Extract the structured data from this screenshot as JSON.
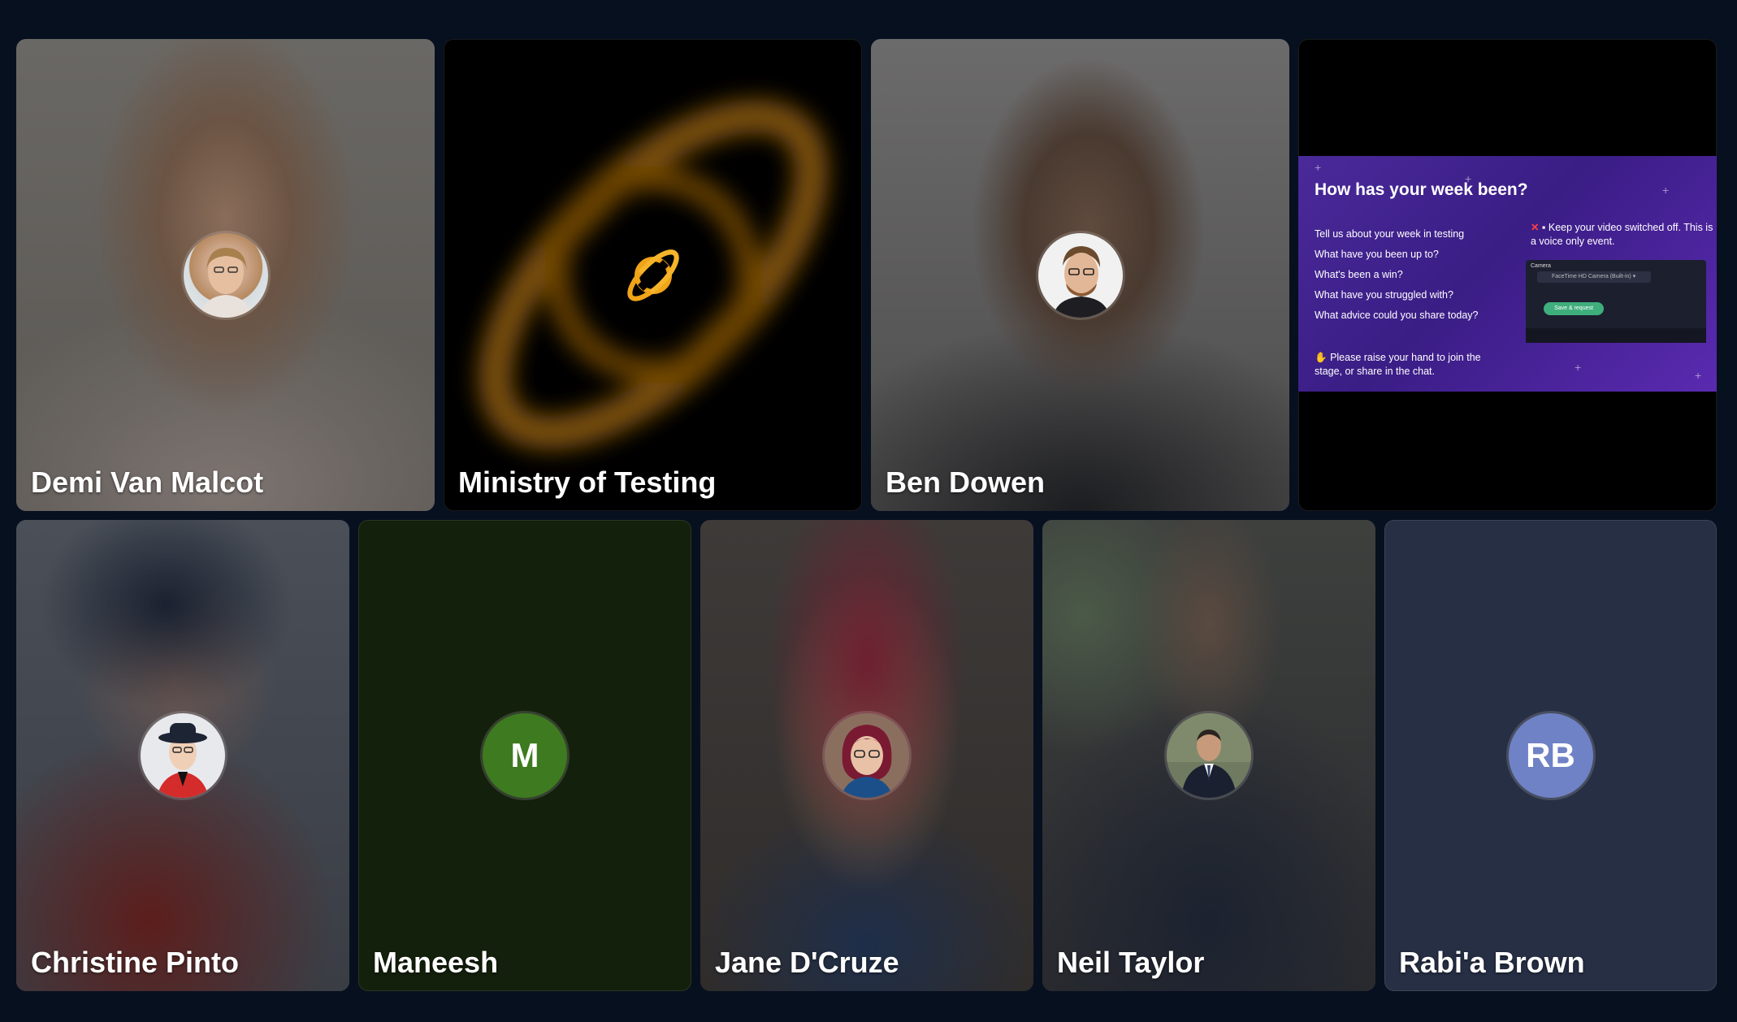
{
  "participants": [
    {
      "name": "Demi Van Malcot",
      "avatar": "photo"
    },
    {
      "name": "Ministry of Testing",
      "avatar": "planet-logo-icon"
    },
    {
      "name": "Ben Dowen",
      "avatar": "photo"
    },
    {
      "name": "Christine Pinto",
      "avatar": "photo"
    },
    {
      "name": "Maneesh",
      "avatar": "initials",
      "initials": "M",
      "color": "#3e7a1f"
    },
    {
      "name": "Jane D'Cruze",
      "avatar": "photo"
    },
    {
      "name": "Neil Taylor",
      "avatar": "photo"
    },
    {
      "name": "Rabi'a Brown",
      "avatar": "initials",
      "initials": "RB",
      "color": "#6f82c6"
    }
  ],
  "screen_share": {
    "title": "How has your week been?",
    "questions": [
      "Tell us about your week in testing",
      "What have you been up to?",
      "What's been a win?",
      "What have you struggled with?",
      "What advice could you share today?"
    ],
    "raise_hand": "Please raise your hand to join the stage, or share in the chat.",
    "video_note": "Keep your video switched off. This is a voice only event.",
    "mini": {
      "camera_label": "Camera",
      "camera_select": "FaceTime HD Camera (Built-in) ▾",
      "save_button": "Save & request"
    }
  },
  "colors": {
    "background": "#07101f",
    "planet_logo": "#f0a418",
    "maneesh_tile": "#13200b",
    "rabia_tile": "#272f45"
  }
}
